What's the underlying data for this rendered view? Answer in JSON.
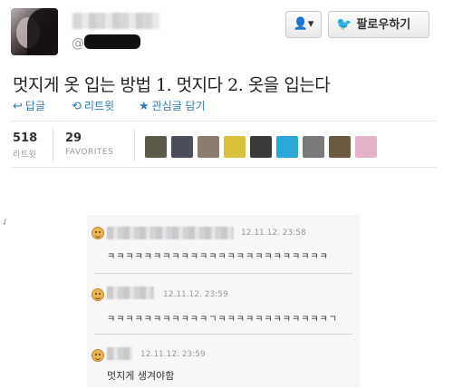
{
  "tweet": {
    "handle_at": "@",
    "follow_icon": "user-menu-icon",
    "follow_label": "팔로우하기",
    "text": "멋지게 옷 입는 방법 1. 멋지다 2. 옷을 입는다",
    "actions": [
      {
        "label": "답글",
        "icon": "reply-icon",
        "glyph": "↩"
      },
      {
        "label": "리트윗",
        "icon": "retweet-icon",
        "glyph": "⟲"
      },
      {
        "label": "관심글 담기",
        "icon": "star-icon",
        "glyph": "★"
      }
    ],
    "stats": {
      "retweets": {
        "count": "518",
        "label": "리트윗"
      },
      "favorites": {
        "count": "29",
        "label": "FAVORITES"
      }
    },
    "fav_avatar_colors": [
      "#5b5a4a",
      "#4a4f5a",
      "#8a7d70",
      "#d9c23a",
      "#3a3a3a",
      "#2aa9d8",
      "#7a7a7a",
      "#6a5a44",
      "#e6b2c8"
    ]
  },
  "comments": [
    {
      "time": "12.11.12. 23:58",
      "text": "ㅋㅋㅋㅋㅋㅋㅋㅋㅋㅋㅋㅋㅋㅋㅋㅋㅋㅋㅋㅋㅋㅋㅋㅋ"
    },
    {
      "time": "12.11.12. 23:59",
      "text": "ㅋㅋㅋㅋㅋㅋㅋㅋㅋㅋㅋㄱㅋㅋㅋㅋㅋㅋㅋㅋㅋㅋㅋㅋㄱ"
    },
    {
      "time": "12.11.12. 23:59",
      "text": "멋지게 생겨야함"
    }
  ]
}
